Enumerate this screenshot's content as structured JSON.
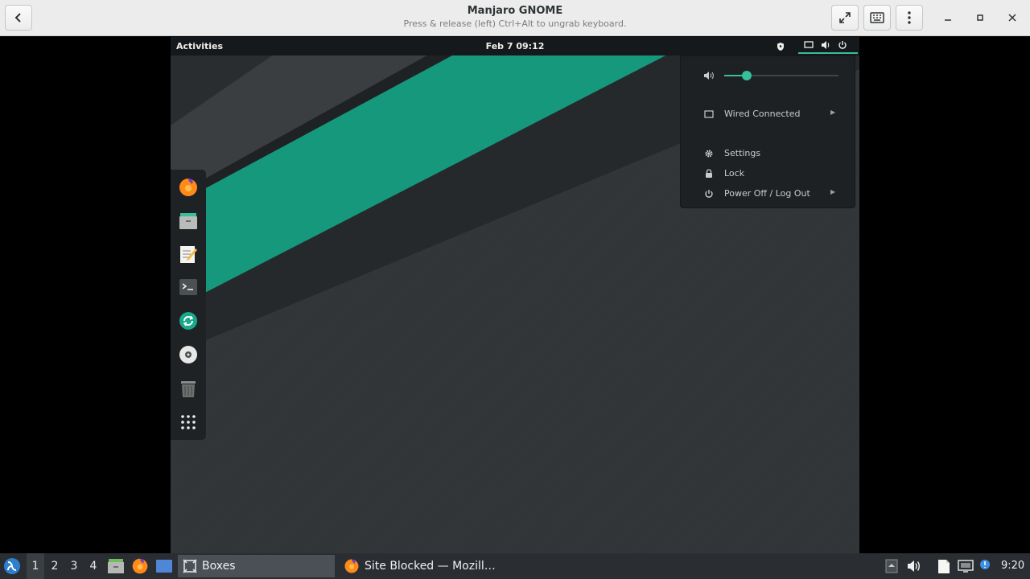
{
  "header": {
    "title": "Manjaro GNOME",
    "subtitle": "Press & release (left) Ctrl+Alt to ungrab keyboard.",
    "icons": [
      "back-icon",
      "fullscreen-icon",
      "keyboard-icon",
      "menu-dots-icon",
      "minimize-icon",
      "maximize-icon",
      "close-icon"
    ]
  },
  "guest": {
    "activities_label": "Activities",
    "clock": "Feb 7  09:12",
    "dock_items": [
      "firefox",
      "files",
      "text-editor",
      "terminal",
      "software-center",
      "disc",
      "trash",
      "app-grid"
    ],
    "menu": {
      "volume_level": 0.2,
      "wired_label": "Wired Connected",
      "settings_label": "Settings",
      "lock_label": "Lock",
      "power_label": "Power Off / Log Out"
    },
    "colors": {
      "accent": "#35bf9a",
      "panel": "#16191b"
    }
  },
  "taskbar": {
    "workspaces": [
      "1",
      "2",
      "3",
      "4"
    ],
    "active_workspace": "1",
    "tasks": [
      {
        "label": "Boxes",
        "active": true
      },
      {
        "label": "Site Blocked — Mozill…",
        "active": false
      }
    ],
    "clock": "9:20"
  }
}
